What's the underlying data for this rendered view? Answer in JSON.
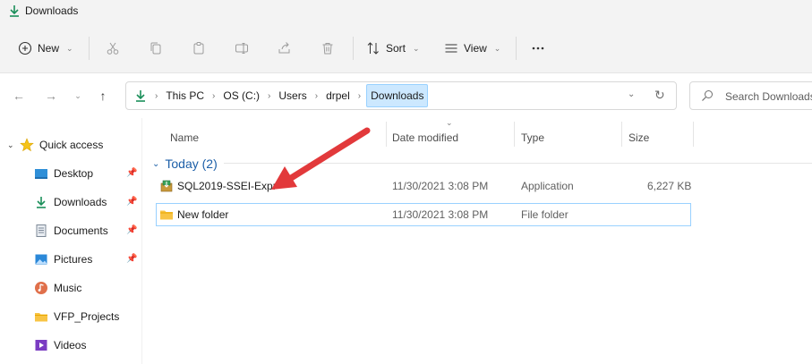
{
  "window": {
    "title": "Downloads",
    "icon": "download-arrow-icon"
  },
  "toolbar": {
    "new_label": "New",
    "sort_label": "Sort",
    "view_label": "View",
    "icons": [
      "cut-icon",
      "copy-icon",
      "paste-icon",
      "rename-icon",
      "share-icon",
      "delete-icon",
      "more-icon"
    ]
  },
  "address": {
    "crumbs": [
      "This PC",
      "OS (C:)",
      "Users",
      "drpel",
      "Downloads"
    ]
  },
  "search": {
    "placeholder": "Search Downloads"
  },
  "sidebar": {
    "items": [
      {
        "label": "Quick access",
        "icon": "star-icon"
      },
      {
        "label": "Desktop",
        "icon": "desktop-icon",
        "pinned": true
      },
      {
        "label": "Downloads",
        "icon": "download-arrow-icon",
        "pinned": true
      },
      {
        "label": "Documents",
        "icon": "document-icon",
        "pinned": true
      },
      {
        "label": "Pictures",
        "icon": "pictures-icon",
        "pinned": true
      },
      {
        "label": "Music",
        "icon": "music-icon"
      },
      {
        "label": "VFP_Projects",
        "icon": "folder-icon"
      },
      {
        "label": "Videos",
        "icon": "videos-icon"
      }
    ]
  },
  "columns": {
    "name": "Name",
    "date": "Date modified",
    "type": "Type",
    "size": "Size"
  },
  "group": {
    "label": "Today (2)"
  },
  "files": [
    {
      "name": "SQL2019-SSEI-Expr",
      "date": "11/30/2021 3:08 PM",
      "type": "Application",
      "size": "6,227 KB",
      "icon": "installer-icon"
    },
    {
      "name": "New folder",
      "date": "11/30/2021 3:08 PM",
      "type": "File folder",
      "size": "",
      "icon": "folder-icon"
    }
  ],
  "colors": {
    "accent": "#0067c0",
    "selection_border": "#99d1ff",
    "annotation": "#e2393b"
  }
}
